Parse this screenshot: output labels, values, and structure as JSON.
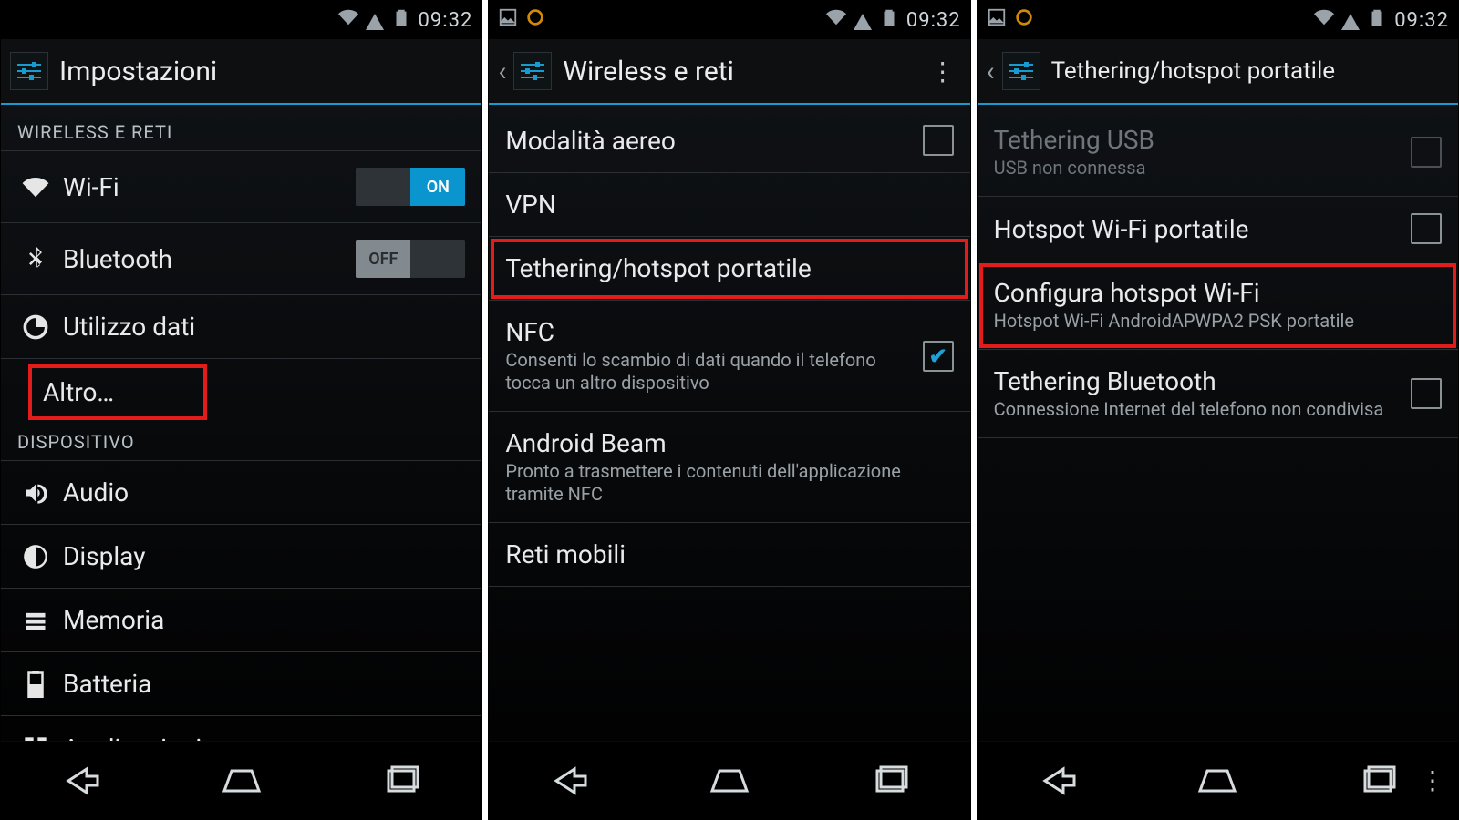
{
  "statusbar": {
    "time": "09:32"
  },
  "screen1": {
    "title": "Impostazioni",
    "section_wireless": "WIRELESS E RETI",
    "wifi": "Wi-Fi",
    "wifi_on": "ON",
    "bluetooth": "Bluetooth",
    "bluetooth_off": "OFF",
    "data_usage": "Utilizzo dati",
    "more": "Altro…",
    "section_device": "DISPOSITIVO",
    "audio": "Audio",
    "display": "Display",
    "storage": "Memoria",
    "battery": "Batteria",
    "apps": "Applicazioni"
  },
  "screen2": {
    "title": "Wireless e reti",
    "airplane": "Modalità aereo",
    "vpn": "VPN",
    "tethering": "Tethering/hotspot portatile",
    "nfc": "NFC",
    "nfc_sub": "Consenti lo scambio di dati quando il telefono tocca un altro dispositivo",
    "beam": "Android Beam",
    "beam_sub": "Pronto a trasmettere i contenuti dell'applicazione tramite NFC",
    "mobile": "Reti mobili"
  },
  "screen3": {
    "title": "Tethering/hotspot portatile",
    "usb": "Tethering USB",
    "usb_sub": "USB non connessa",
    "hotspot": "Hotspot Wi-Fi portatile",
    "configure": "Configura hotspot Wi-Fi",
    "configure_sub": "Hotspot Wi-Fi AndroidAPWPA2 PSK portatile",
    "bt": "Tethering Bluetooth",
    "bt_sub": "Connessione Internet del telefono non condivisa"
  }
}
